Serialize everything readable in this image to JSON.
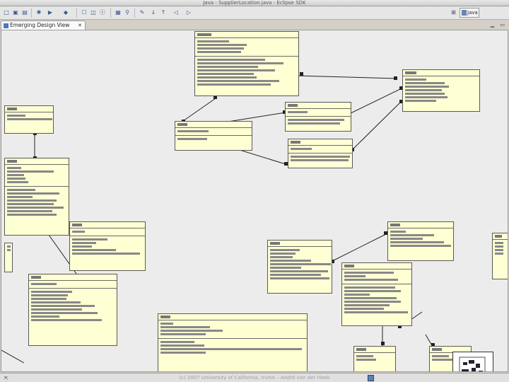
{
  "window": {
    "title": "Java - SupplierLocation.java - Eclipse SDK"
  },
  "toolbar": {
    "buttons": [
      {
        "name": "new-button",
        "glyph": "□"
      },
      {
        "name": "save-button",
        "glyph": "▣"
      },
      {
        "name": "print-button",
        "glyph": "▤"
      },
      {
        "name": "debug-button",
        "glyph": "✱"
      },
      {
        "name": "run-button",
        "glyph": "▶"
      },
      {
        "name": "external-tools-button",
        "glyph": "◆"
      },
      {
        "name": "new-java-project-button",
        "glyph": "☐"
      },
      {
        "name": "new-package-button",
        "glyph": "◫"
      },
      {
        "name": "new-class-button",
        "glyph": "ⓒ"
      },
      {
        "name": "open-type-button",
        "glyph": "▦"
      },
      {
        "name": "search-button",
        "glyph": "⚲"
      },
      {
        "name": "annotation-button",
        "glyph": "✎"
      },
      {
        "name": "next-annotation-button",
        "glyph": "↓"
      },
      {
        "name": "previous-annotation-button",
        "glyph": "↑"
      },
      {
        "name": "back-button",
        "glyph": "◁"
      },
      {
        "name": "forward-button",
        "glyph": "▷"
      }
    ]
  },
  "perspective": {
    "label": "Java"
  },
  "view": {
    "tab_label": "Emerging Design View",
    "close_glyph": "✕",
    "minimize_glyph": "▁",
    "maximize_glyph": "▭"
  },
  "footer": {
    "copyright": "(c) 2007 University of California, Irvine – André van der Hoek"
  },
  "colors": {
    "class_fill": "#ffffd4",
    "class_border": "#5a5a5a",
    "canvas": "#ececec",
    "connector": "#222222"
  }
}
